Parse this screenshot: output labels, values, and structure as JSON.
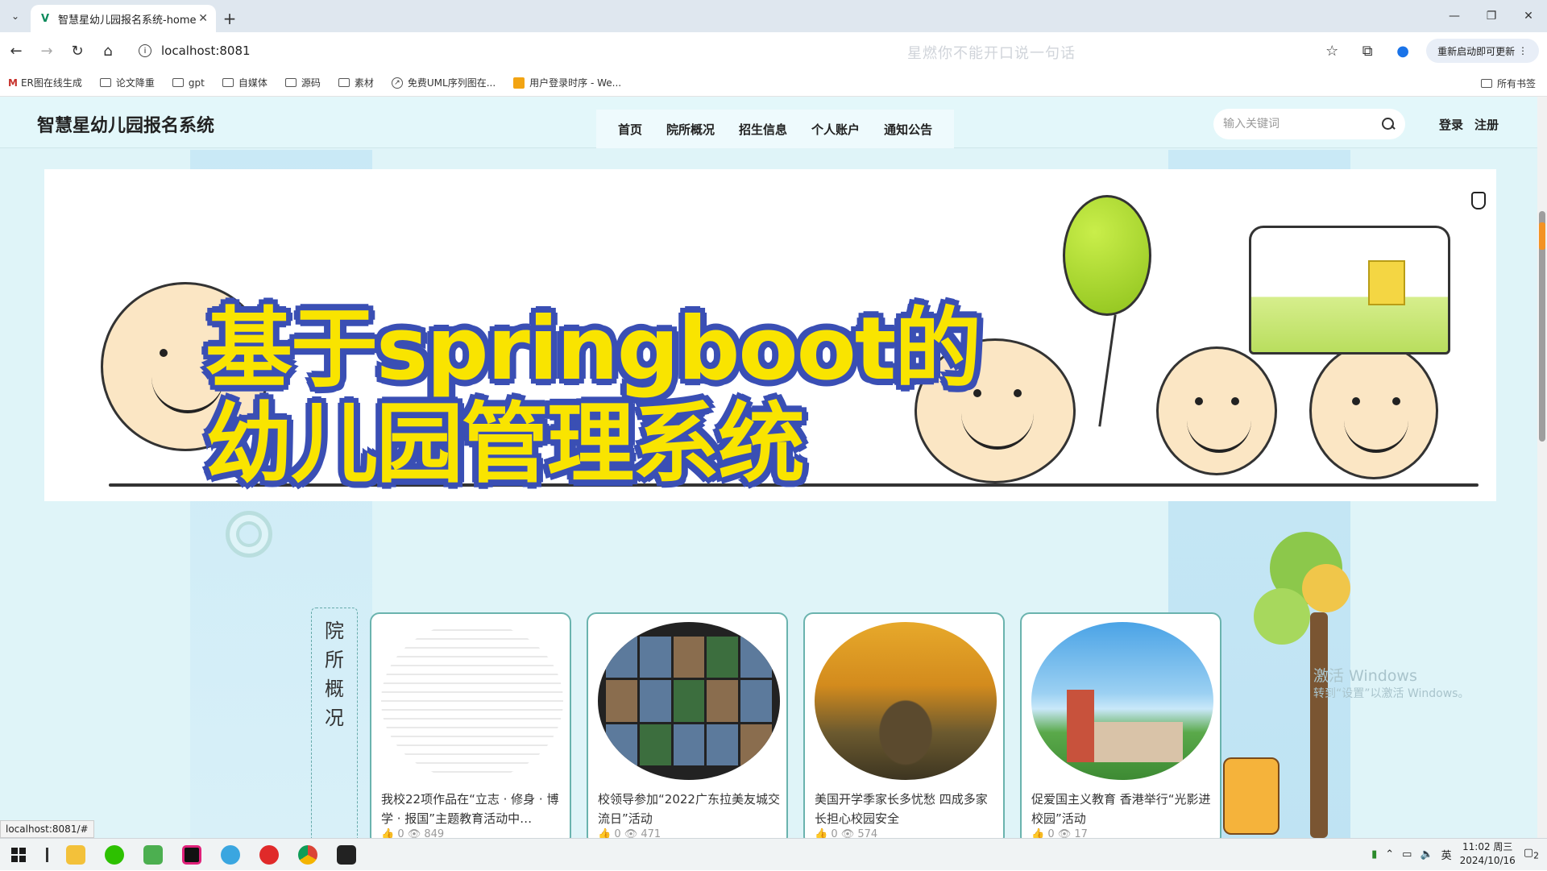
{
  "browser": {
    "tab_title": "智慧星幼儿园报名系统-home",
    "url": "localhost:8081",
    "ghost_text": "星燃你不能开口说一句话",
    "update_button": "重新启动即可更新",
    "bookmarks": [
      {
        "label": "ER图在线生成",
        "icon": "gmail-icon"
      },
      {
        "label": "论文降重",
        "icon": "folder-icon"
      },
      {
        "label": "gpt",
        "icon": "folder-icon"
      },
      {
        "label": "自媒体",
        "icon": "folder-icon"
      },
      {
        "label": "源码",
        "icon": "folder-icon"
      },
      {
        "label": "素材",
        "icon": "folder-icon"
      },
      {
        "label": "免费UML序列图在...",
        "icon": "compass-icon"
      },
      {
        "label": "用户登录时序 - We...",
        "icon": "bookmark-app-icon"
      }
    ],
    "all_bookmarks": "所有书签",
    "status_url": "localhost:8081/#"
  },
  "site": {
    "logo": "智慧星幼儿园报名系统",
    "nav": [
      "首页",
      "院所概况",
      "招生信息",
      "个人账户",
      "通知公告"
    ],
    "search_placeholder": "输入关键词",
    "login": "登录",
    "register": "注册",
    "banner_line1": "基于springboot的",
    "banner_line2": "幼儿园管理系统"
  },
  "section": {
    "label_chars": [
      "院",
      "所",
      "概",
      "况"
    ],
    "cards": [
      {
        "title": "我校22项作品在“立志 · 修身 · 博学 · 报国”主题教育活动中…",
        "stats": "👍 0 👁 849",
        "image": "document-image"
      },
      {
        "title": "校领导参加“2022广东拉美友城交流日”活动",
        "stats": "👍 0 👁 471",
        "image": "video-meeting-image"
      },
      {
        "title": "美国开学季家长多忧愁 四成多家长担心校园安全",
        "stats": "👍 0 👁 574",
        "image": "campus-autumn-image"
      },
      {
        "title": "促爱国主义教育 香港举行“光影进校园”活动",
        "stats": "👍 0 👁 17",
        "image": "school-building-image"
      }
    ]
  },
  "watermark": {
    "line1": "激活 Windows",
    "line2": "转到“设置”以激活 Windows。"
  },
  "taskbar": {
    "time": "11:02 周三",
    "date": "2024/10/16",
    "ime": "英",
    "notifications": "2"
  },
  "colors": {
    "accent": "#3a4fb4",
    "banner_text": "#f9e400",
    "page_bg": "#dff4f8",
    "card_border": "#6ab3ae"
  }
}
